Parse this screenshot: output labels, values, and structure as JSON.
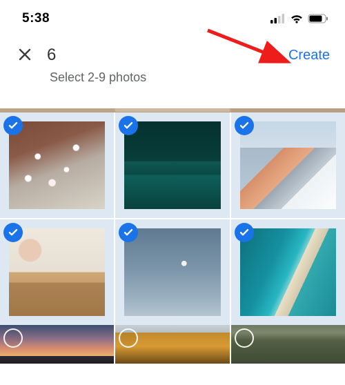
{
  "status_bar": {
    "time": "5:38"
  },
  "header": {
    "count": "6",
    "subtitle": "Select 2-9 photos",
    "create_label": "Create"
  },
  "accent_color": "#1a73e8",
  "grid": {
    "photos": [
      {
        "name": "cherry-blossoms",
        "selected": true
      },
      {
        "name": "dark-ocean-waves",
        "selected": true
      },
      {
        "name": "snowy-mountain-peak",
        "selected": true
      },
      {
        "name": "desk-with-art",
        "selected": true
      },
      {
        "name": "crescent-moon-sky",
        "selected": true
      },
      {
        "name": "aerial-beach",
        "selected": true
      },
      {
        "name": "mountain-sunset",
        "selected": false
      },
      {
        "name": "autumn-hills",
        "selected": false
      },
      {
        "name": "forest-path",
        "selected": false
      }
    ]
  }
}
